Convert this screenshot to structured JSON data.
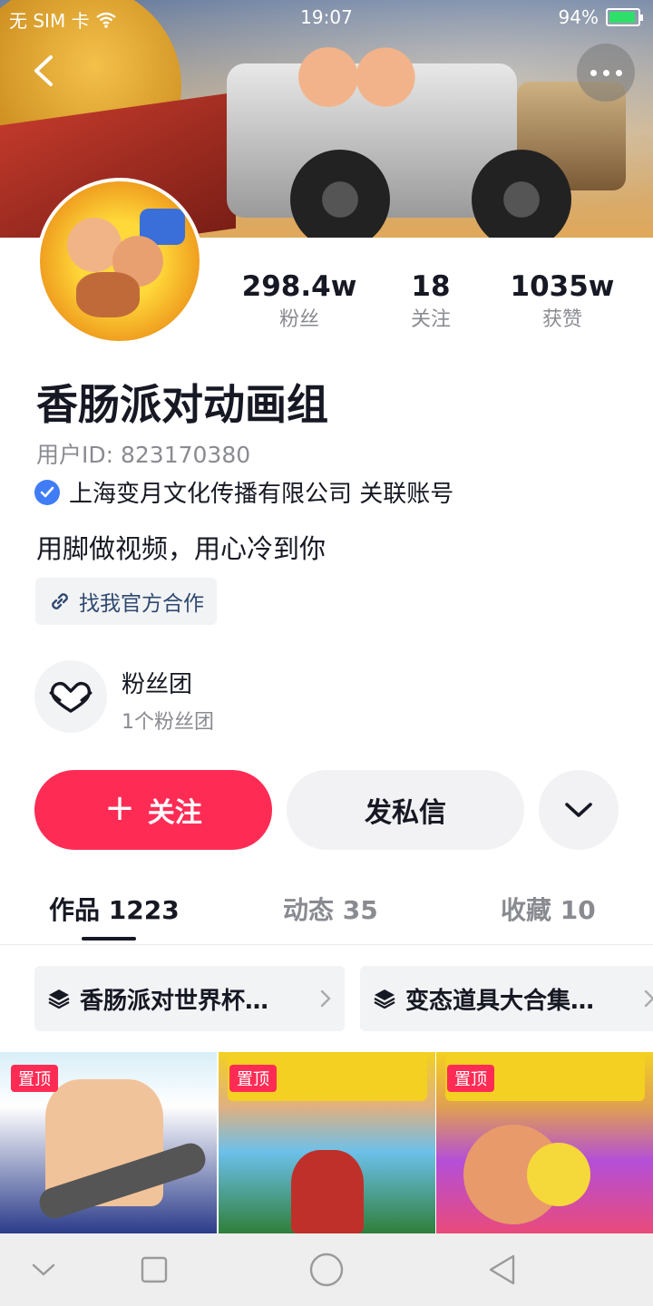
{
  "status_bar": {
    "sim": "无 SIM 卡",
    "time": "19:07",
    "battery": "94%",
    "battery_level": 0.94
  },
  "header": {
    "back_icon": "chevron-left-icon",
    "more_icon": "more-dots-icon"
  },
  "profile": {
    "name": "香肠派对动画组",
    "user_id": "用户ID: 823170380",
    "verified_text": "上海变月文化传播有限公司 关联账号",
    "bio": "用脚做视频，用心冷到你",
    "coop_label": "找我官方合作"
  },
  "stats": [
    {
      "value": "298.4w",
      "label": "粉丝"
    },
    {
      "value": "18",
      "label": "关注"
    },
    {
      "value": "1035w",
      "label": "获赞"
    }
  ],
  "fan_club": {
    "title": "粉丝团",
    "subtitle": "1个粉丝团"
  },
  "actions": {
    "follow": "关注",
    "follow_icon": "+",
    "message": "发私信"
  },
  "tabs": [
    {
      "label": "作品 1223",
      "active": true
    },
    {
      "label": "动态 35",
      "active": false
    },
    {
      "label": "收藏 10",
      "active": false
    }
  ],
  "collections": [
    {
      "label": "香肠派对世界杯…"
    },
    {
      "label": "变态道具大合集…"
    }
  ],
  "videos": [
    {
      "pin": "置顶"
    },
    {
      "pin": "置顶"
    },
    {
      "pin": "置顶"
    }
  ],
  "colors": {
    "accent": "#fe2c55",
    "verify_blue": "#3f7cf6",
    "link": "#2f4870"
  }
}
